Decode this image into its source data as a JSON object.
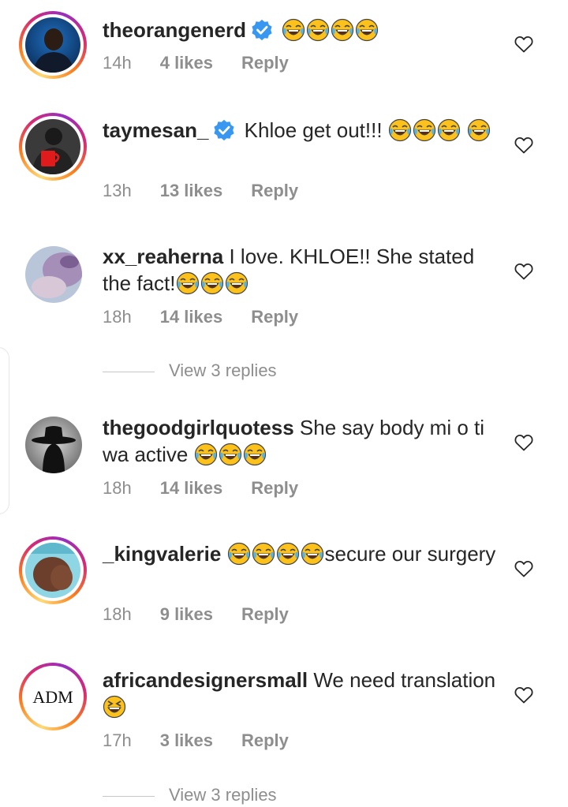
{
  "comments": [
    {
      "username": "theorangenerd",
      "verified": true,
      "text": "",
      "emojis_after": "😂😂😂😂",
      "time": "14h",
      "likes": "4 likes",
      "reply": "Reply",
      "avatar": "man-dark-portrait"
    },
    {
      "username": "taymesan_",
      "verified": true,
      "text": "Khloe get out!!!",
      "emojis_after": "😂😂😂😂",
      "time": "13h",
      "likes": "13 likes",
      "reply": "Reply",
      "avatar": "man-with-red-mug"
    },
    {
      "username": "xx_reaherna",
      "verified": false,
      "text": "I love. KHLOE!! She stated the fact!",
      "emojis_after": "😂😂😂",
      "time": "18h",
      "likes": "14 likes",
      "reply": "Reply",
      "avatar": "purple-pastel-photo",
      "view_replies": "View 3 replies"
    },
    {
      "username": "thegoodgirlquotess",
      "verified": false,
      "text": "She say body mi o ti wa active",
      "emojis_after": "😂😂😂",
      "time": "18h",
      "likes": "14 likes",
      "reply": "Reply",
      "avatar": "hat-silhouette"
    },
    {
      "username": "_kingvalerie",
      "verified": false,
      "text": "secure our surgery",
      "emojis_before": "😂😂😂😂",
      "time": "18h",
      "likes": "9 likes",
      "reply": "Reply",
      "avatar": "cyan-body-photo"
    },
    {
      "username": "africandesignersmall",
      "verified": false,
      "text": "We need translation",
      "emojis_after": "😆",
      "time": "17h",
      "likes": "3 likes",
      "reply": "Reply",
      "avatar": "adm-logo",
      "avatar_logo_text": "ADM",
      "view_replies": "View 3 replies"
    }
  ],
  "icons": {
    "like": "heart-outline-icon",
    "verified": "verified-badge-icon",
    "emoji": "tears-of-joy-emoji"
  },
  "colors": {
    "text": "#262626",
    "meta": "#8e8e8e",
    "verified": "#3897f0",
    "divider": "#c7c7c7"
  }
}
